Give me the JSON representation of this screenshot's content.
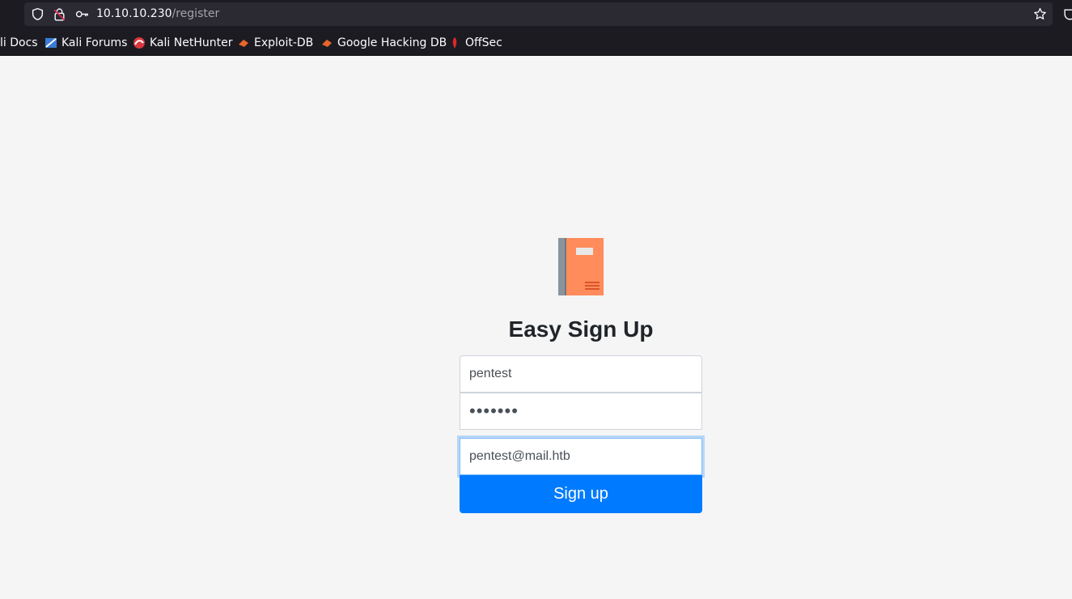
{
  "browser": {
    "url_host": "10.10.10.230",
    "url_path": "/register",
    "bookmarks": [
      {
        "label": "li Docs",
        "icon": "kali-docs-icon"
      },
      {
        "label": "Kali Forums",
        "icon": "kali-forums-icon"
      },
      {
        "label": "Kali NetHunter",
        "icon": "kali-nethunter-icon"
      },
      {
        "label": "Exploit-DB",
        "icon": "exploit-db-icon"
      },
      {
        "label": "Google Hacking DB",
        "icon": "google-hacking-db-icon"
      },
      {
        "label": "OffSec",
        "icon": "offsec-icon"
      }
    ]
  },
  "form": {
    "title": "Easy Sign Up",
    "username_value": "pentest",
    "password_value": "•••••••",
    "email_value": "pentest@mail.htb",
    "submit_label": "Sign up"
  },
  "colors": {
    "chrome_bg": "#1c1b22",
    "urlbar_bg": "#2b2a33",
    "page_bg": "#f5f5f5",
    "button_bg": "#007bff",
    "book_cover": "#ff8c5a",
    "book_spine": "#8a939b"
  }
}
